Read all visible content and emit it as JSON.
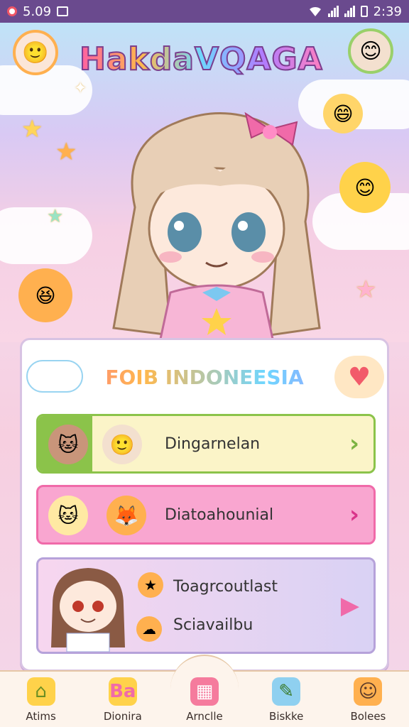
{
  "status_bar": {
    "left_time": "5.09",
    "right_time": "2:39"
  },
  "header": {
    "logo_text": "HakdaVQAGA"
  },
  "panel": {
    "title": "FOIB INDONEESIA",
    "rows": [
      {
        "label": "Dingarnelan",
        "chevron": "›"
      },
      {
        "label": "Diatoahounial",
        "chevron": "›"
      },
      {
        "label_line1": "Toagrcoutlast",
        "label_line2": "Sciavailbu",
        "chevron": "›"
      }
    ]
  },
  "nav": {
    "items": [
      {
        "label": "Atims",
        "icon": "home-icon"
      },
      {
        "label": "Dionira",
        "icon": "letters-icon"
      },
      {
        "label": "Arnclle",
        "icon": "gift-icon"
      },
      {
        "label": "Biskke",
        "icon": "pencil-icon"
      },
      {
        "label": "Bolees",
        "icon": "person-icon"
      }
    ]
  }
}
